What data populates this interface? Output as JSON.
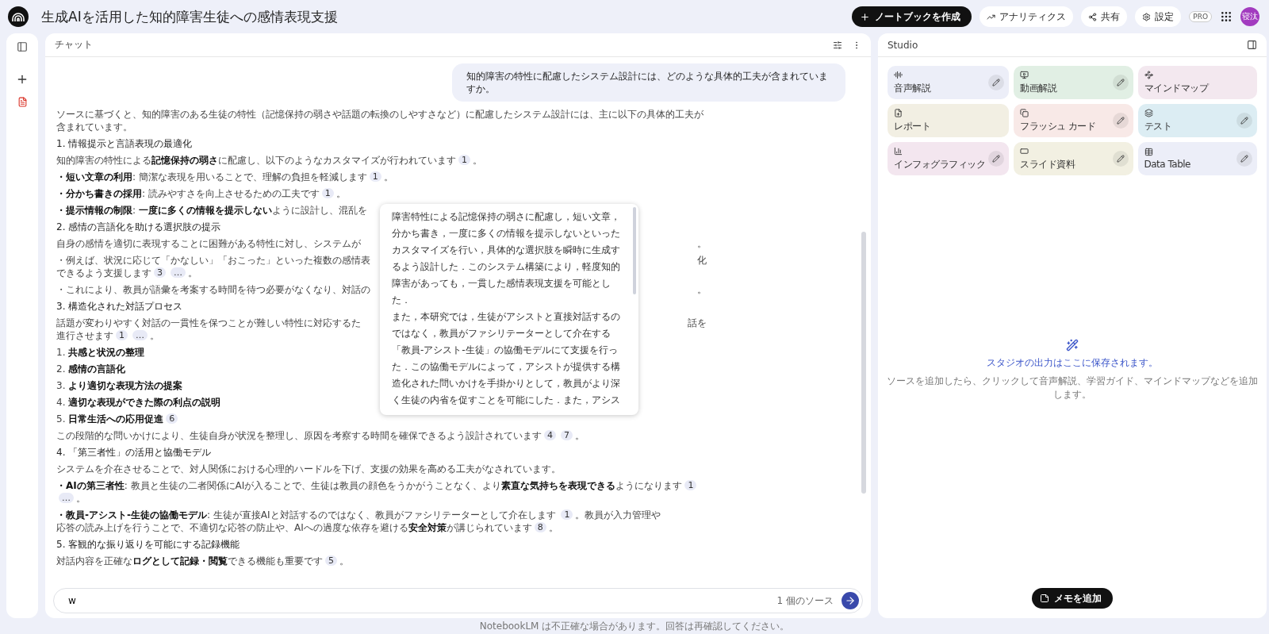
{
  "header": {
    "title": "生成AIを活用した知的障害生徒への感情表現支援",
    "create_button": "ノートブックを作成",
    "actions": [
      "アナリティクス",
      "共有",
      "設定"
    ],
    "plan_badge": "PRO",
    "avatar": "寝汰"
  },
  "chat": {
    "title": "チャット",
    "user_message": "知的障害の特性に配慮したシステム設計には、どのような具体的工夫が含まれていますか。",
    "answer": [
      {
        "kind": "text",
        "text": "ソースに基づくと、知的障害のある生徒の特性（記憶保持の弱さや話題の転換のしやすさなど）に配慮したシステム設計には、主に以下の具体的工夫が含まれています。"
      },
      {
        "kind": "heading",
        "text": "1. 情報提示と言語表現の最適化"
      },
      {
        "kind": "text",
        "text": "知的障害の特性による**記憶保持の弱さ**に配慮し、以下のようなカスタマイズが行われています",
        "cites": [
          "1"
        ],
        "end": "。"
      },
      {
        "kind": "text",
        "text": "**・短い文章の利用**: 簡潔な表現を用いることで、理解の負担を軽減します",
        "cites": [
          "1"
        ],
        "end": "。"
      },
      {
        "kind": "text",
        "text": "**・分かち書きの採用**: 読みやすさを向上させるための工夫です",
        "cites": [
          "1"
        ],
        "end": "。"
      },
      {
        "kind": "split",
        "left": "**・提示情報の制限**: **一度に多くの情報を提示しない**ように設計し、混乱を"
      },
      {
        "kind": "heading",
        "text": "2. 感情の言語化を助ける選択肢の提示"
      },
      {
        "kind": "split",
        "left": "自身の感情を適切に表現することに困難がある特性に対し、システムが",
        "right": "。"
      },
      {
        "kind": "split",
        "left": "・例えば、状況に応じて「かなしい」「おこった」といった複数の感情表",
        "right": "化",
        "cont": "できるよう支援します",
        "cites": [
          "3",
          "…"
        ],
        "end": "。"
      },
      {
        "kind": "split",
        "left": "・これにより、教員が語彙を考案する時間を待つ必要がなくなり、対話の",
        "right": "。"
      },
      {
        "kind": "heading",
        "text": "3. 構造化された対話プロセス"
      },
      {
        "kind": "split",
        "left": "話題が変わりやすく対話の一貫性を保つことが難しい特性に対応するた",
        "right": "話を",
        "cont": "進行させます",
        "cites": [
          "1",
          "…"
        ],
        "end": "。"
      },
      {
        "kind": "text",
        "text": "1. **共感と状況の整理**"
      },
      {
        "kind": "text",
        "text": "2. **感情の言語化**"
      },
      {
        "kind": "text",
        "text": "3. **より適切な表現方法の提案**"
      },
      {
        "kind": "text",
        "text": "4. **適切な表現ができた際の利点の説明**"
      },
      {
        "kind": "text",
        "text": "5. **日常生活への応用促進**",
        "cites": [
          "6"
        ]
      },
      {
        "kind": "text",
        "text": "この段階的な問いかけにより、生徒自身が状況を整理し、原因を考察する時間を確保できるよう設計されています",
        "cites": [
          "4",
          "7"
        ],
        "end": "。"
      },
      {
        "kind": "heading",
        "text": "4. 「第三者性」の活用と協働モデル"
      },
      {
        "kind": "text",
        "text": "システムを介在させることで、対人関係における心理的ハードルを下げ、支援の効果を高める工夫がなされています。"
      },
      {
        "kind": "text",
        "text": "**・AIの第三者性**: 教員と生徒の二者関係にAIが入ることで、生徒は教員の顔色をうかがうことなく、より**素直な気持ちを表現できる**ようになります",
        "cites": [
          "1",
          "…"
        ],
        "end": "。"
      },
      {
        "kind": "text",
        "text": "**・教員-アシスト-生徒の協働モデル**: 生徒が直接AIと対話するのではなく、教員がファシリテーターとして介在します ",
        "cites": [
          "1"
        ],
        "end": "。教員が入力管理や",
        "cont": "応答の読み上げを行うことで、不適切な応答の防止や、AIへの過度な依存を避ける**安全対策**が講じられています",
        "cites2": [
          "8"
        ],
        "end2": "。"
      },
      {
        "kind": "heading",
        "text": "5. 客観的な振り返りを可能にする記録機能"
      },
      {
        "kind": "text",
        "text": "対話内容を正確な**ログとして記録・閲覧**できる機能も重要です",
        "cites": [
          "5"
        ],
        "end": "。"
      }
    ],
    "popup": [
      "障害特性による記憶保持の弱さに配慮し，短い文章，分かち書き，一度に多くの情報を提示しないといったカスタマイズを行い，具体的な選択肢を瞬時に生成するよう設計した．このシステム構築により，軽度知的障害があっても，一貫した感情表現支援を可能とした．",
      "また，本研究では，生徒がアシストと直接対話するのではなく，教員がファシリテーターとして介在する「教員-アシスト-生徒」の協働モデルにて支援を行った．この協働モデルによって，アシストが提供する構造化された問いかけを手掛かりとして，教員がより深く生徒の内省を促すことを可能にした．また，アシス"
    ],
    "input": {
      "value": "w",
      "source_count": "1 個のソース"
    }
  },
  "studio": {
    "title": "Studio",
    "tools": [
      {
        "label": "音声解説",
        "color": "#eceef8",
        "edit": true
      },
      {
        "label": "動画解説",
        "color": "#e1efe4",
        "edit": true
      },
      {
        "label": "マインドマップ",
        "color": "#f3e8ef",
        "edit": false
      },
      {
        "label": "レポート",
        "color": "#f2efe3",
        "edit": false
      },
      {
        "label": "フラッシュ カード",
        "color": "#f8e9e7",
        "edit": true
      },
      {
        "label": "テスト",
        "color": "#dcedf3",
        "edit": true
      },
      {
        "label": "インフォグラフィック",
        "color": "#f3e6ef",
        "edit": true
      },
      {
        "label": "スライド資料",
        "color": "#f2f0e2",
        "edit": true
      },
      {
        "label": "Data Table",
        "color": "#eceef8",
        "edit": true
      }
    ],
    "empty_title": "スタジオの出力はここに保存されます。",
    "empty_text": "ソースを追加したら、クリックして音声解説、学習ガイド、マインドマップなどを追加します。",
    "note_button": "メモを追加"
  },
  "footer": "NotebookLM は不正確な場合があります。回答は再確認してください。"
}
